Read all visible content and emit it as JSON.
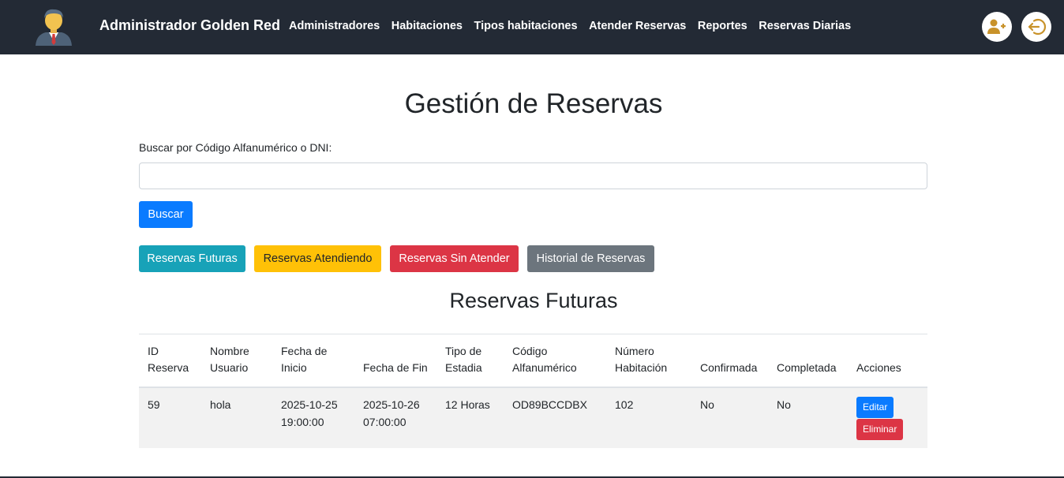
{
  "navbar": {
    "brand": "Administrador Golden Red",
    "links": [
      {
        "label": "Administradores"
      },
      {
        "label": "Habitaciones"
      },
      {
        "label": "Tipos habitaciones"
      },
      {
        "label": "Atender Reservas"
      },
      {
        "label": "Reportes"
      },
      {
        "label": "Reservas Diarias"
      }
    ],
    "accent_color": "#c8922a"
  },
  "page": {
    "title": "Gestión de Reservas"
  },
  "search": {
    "label": "Buscar por Código Alfanumérico o DNI:",
    "value": "",
    "button_label": "Buscar"
  },
  "filters": {
    "futuras": "Reservas Futuras",
    "atendiendo": "Reservas Atendiendo",
    "sin_atender": "Reservas Sin Atender",
    "historial": "Historial de Reservas"
  },
  "section": {
    "title": "Reservas Futuras"
  },
  "table": {
    "headers": {
      "id_a": "ID",
      "id_b": "Reserva",
      "user_a": "Nombre",
      "user_b": "Usuario",
      "start_a": "Fecha de",
      "start_b": "Inicio",
      "end": "Fecha de Fin",
      "stay_a": "Tipo de",
      "stay_b": "Estadia",
      "code_a": "Código",
      "code_b": "Alfanumérico",
      "room_a": "Número",
      "room_b": "Habitación",
      "confirmed": "Confirmada",
      "completed": "Completada",
      "actions": "Acciones"
    },
    "rows": [
      {
        "id": "59",
        "user": "hola",
        "start_date": "2025-10-25",
        "start_time": "19:00:00",
        "end_date": "2025-10-26",
        "end_time": "07:00:00",
        "stay": "12 Horas",
        "code": "OD89BCCDBX",
        "room": "102",
        "confirmed": "No",
        "completed": "No",
        "edit_label": "Editar",
        "delete_label": "Eliminar"
      }
    ]
  }
}
